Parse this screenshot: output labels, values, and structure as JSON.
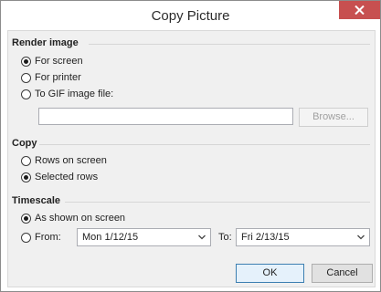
{
  "window": {
    "title": "Copy Picture"
  },
  "render_image": {
    "heading": "Render image",
    "options": [
      "For screen",
      "For printer",
      "To GIF image file:"
    ],
    "selected": 0,
    "file_path": "",
    "browse_label": "Browse..."
  },
  "copy": {
    "heading": "Copy",
    "options": [
      "Rows on screen",
      "Selected rows"
    ],
    "selected": 1
  },
  "timescale": {
    "heading": "Timescale",
    "options": [
      "As shown on screen",
      "From:"
    ],
    "selected": 0,
    "from_value": "Mon 1/12/15",
    "to_label": "To:",
    "to_value": "Fri 2/13/15"
  },
  "buttons": {
    "ok": "OK",
    "cancel": "Cancel"
  },
  "colors": {
    "close_button": "#c75050",
    "default_button_border": "#3c7fb1"
  }
}
